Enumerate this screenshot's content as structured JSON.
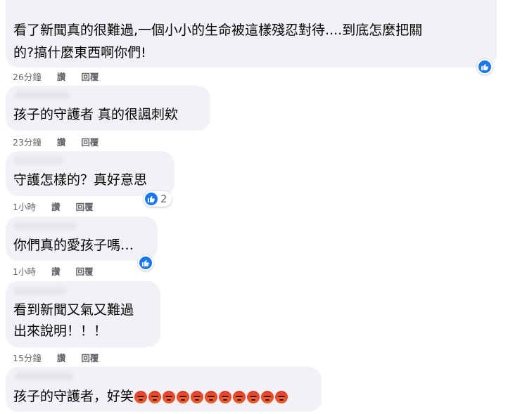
{
  "comments": [
    {
      "lines": [
        "看了新聞真的很難過,一個小小的生命被這樣殘忍對待....到底怎麼把關",
        "的?搞什麼東西啊你們!"
      ],
      "time": "26分鐘",
      "read": "讚",
      "reply": "回覆",
      "reaction": "like-icon",
      "reaction_count": ""
    },
    {
      "lines": [
        "孩子的守護者 真的很諷刺欸"
      ],
      "time": "23分鐘",
      "read": "讚",
      "reply": "回覆"
    },
    {
      "lines": [
        "守護怎樣的？真好意思"
      ],
      "time": "1小時",
      "read": "讚",
      "reply": "回覆",
      "reaction": "like-icon",
      "reaction_count": "2"
    },
    {
      "lines": [
        "你們真的愛孩子嗎…"
      ],
      "time": "1小時",
      "read": "讚",
      "reply": "回覆",
      "reaction": "like-icon",
      "reaction_count": ""
    },
    {
      "lines": [
        "看到新聞又氣又難過",
        "出來說明！！！"
      ],
      "time": "15分鐘",
      "read": "讚",
      "reply": "回覆"
    },
    {
      "lines": [
        "孩子的守護者，好笑"
      ],
      "emoji": "angry-face-icon",
      "emoji_count": 11
    }
  ],
  "colors": {
    "bubble": "#f0f2f5",
    "meta_text": "#65676b",
    "like_blue": "#1877f2"
  }
}
